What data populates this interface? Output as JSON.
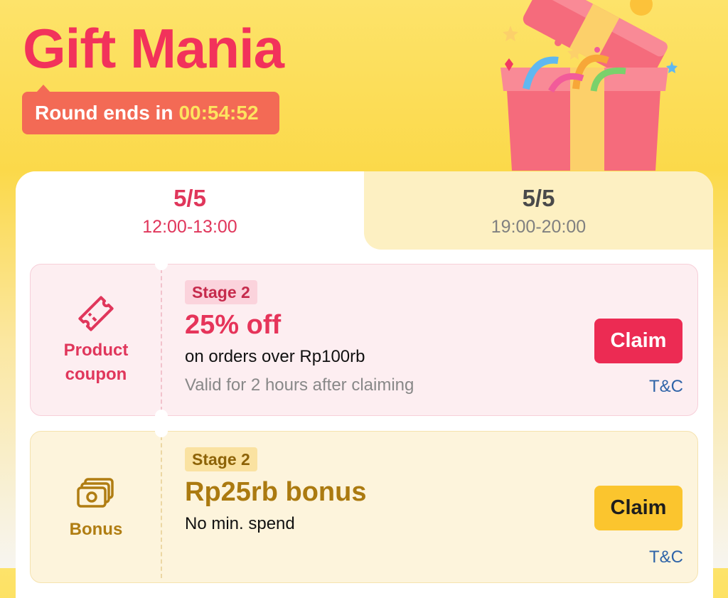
{
  "header": {
    "title": "Gift Mania",
    "timer_prefix": "Round ends in",
    "timer_value": "00:54:52"
  },
  "tabs": [
    {
      "date": "5/5",
      "time": "12:00-13:00",
      "active": true
    },
    {
      "date": "5/5",
      "time": "19:00-20:00",
      "active": false
    }
  ],
  "cards": [
    {
      "type_label": "Product coupon",
      "icon": "ticket-icon",
      "stage": "Stage 2",
      "headline": "25% off",
      "line1": "on orders over Rp100rb",
      "line2": "Valid for 2 hours after claiming",
      "claim_label": "Claim",
      "tc_label": "T&C"
    },
    {
      "type_label": "Bonus",
      "icon": "cash-icon",
      "stage": "Stage 2",
      "headline": "Rp25rb bonus",
      "line1": "No min. spend",
      "claim_label": "Claim",
      "tc_label": "T&C"
    }
  ],
  "colors": {
    "brand_red": "#f2325b",
    "timer_bg": "#f36a55",
    "timer_accent": "#fde35f",
    "coupon_button": "#ec2b53",
    "bonus_button": "#fbc52e",
    "link": "#2f64a8"
  }
}
